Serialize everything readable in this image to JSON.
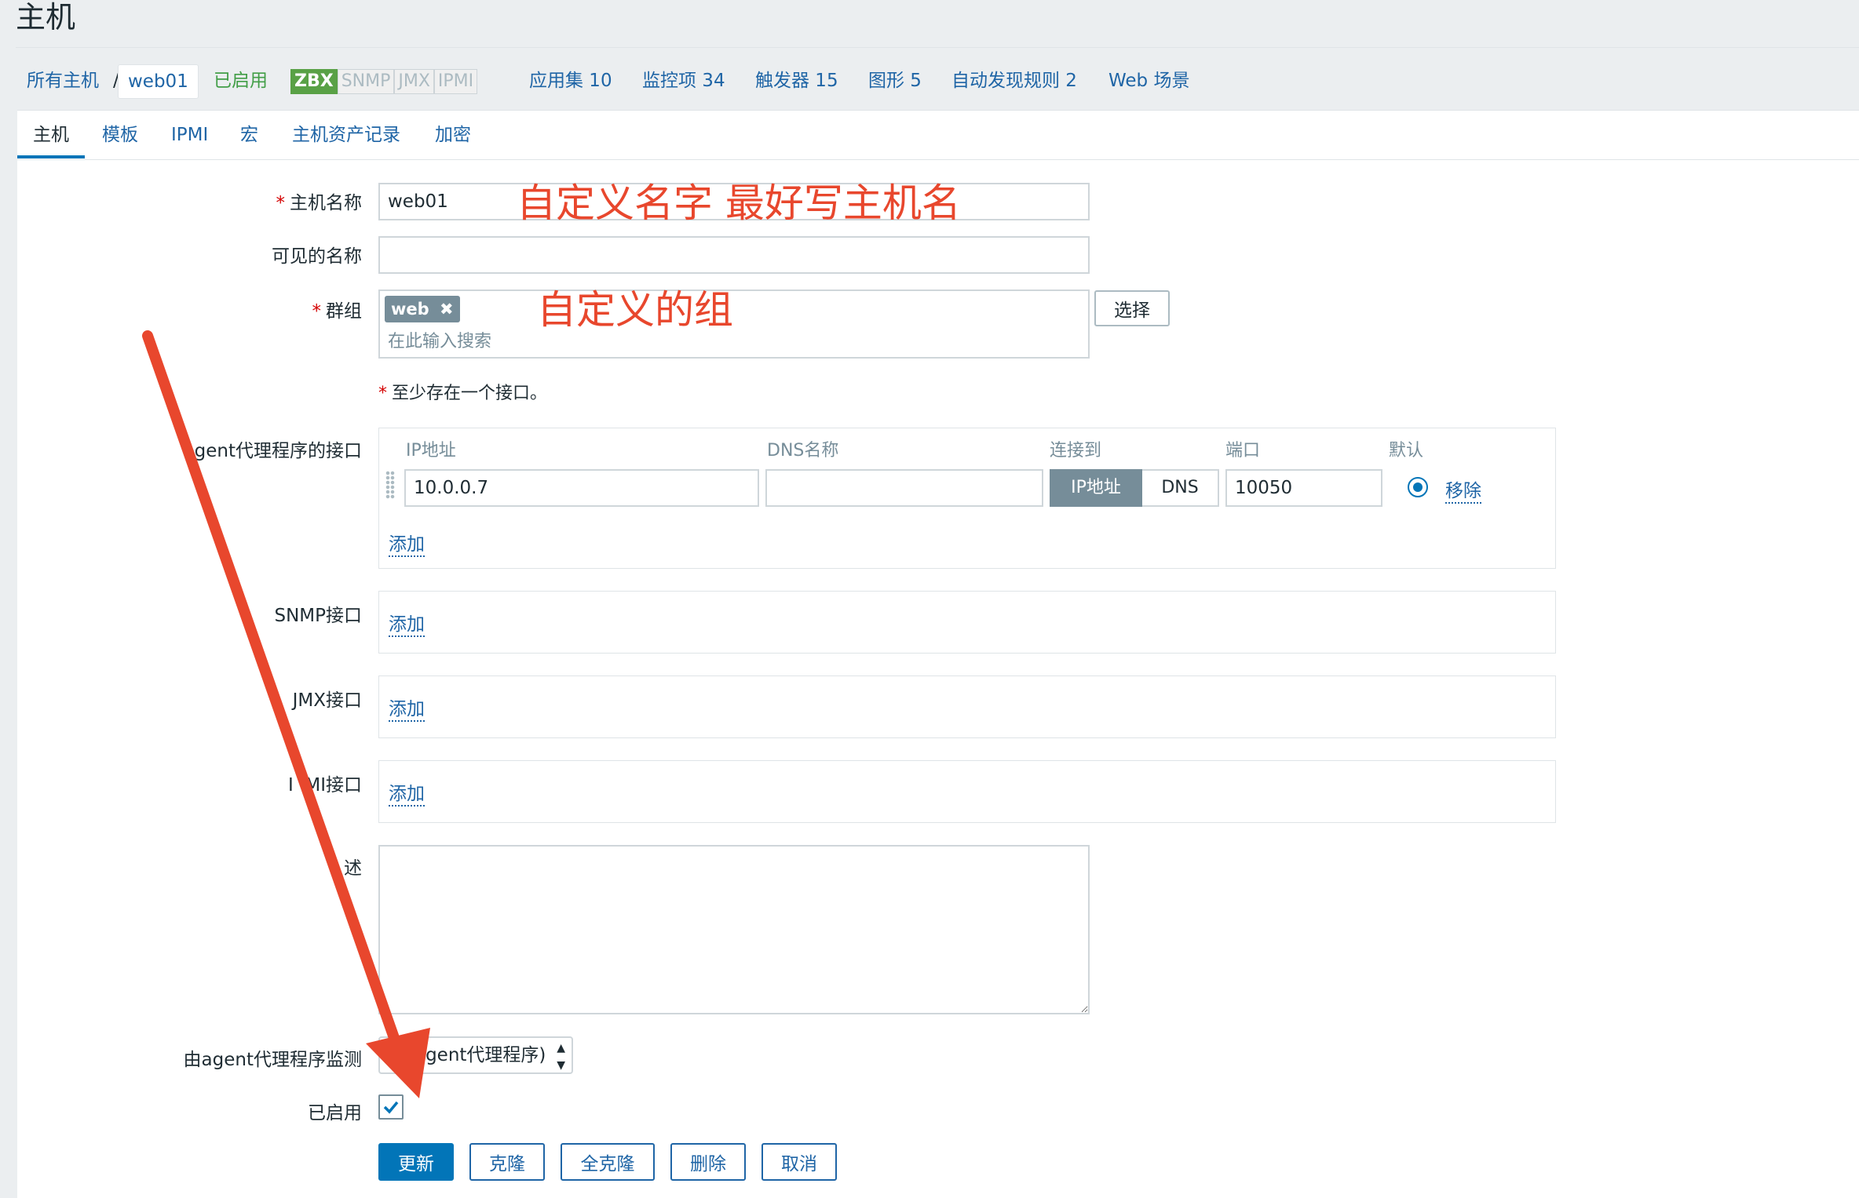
{
  "page": {
    "title": "主机"
  },
  "nav": {
    "all_hosts": "所有主机",
    "separator": "/",
    "current_host": "web01",
    "status": "已启用",
    "interfaces": [
      "ZBX",
      "SNMP",
      "JMX",
      "IPMI"
    ],
    "applications": "应用集 10",
    "items": "监控项 34",
    "triggers": "触发器 15",
    "graphs": "图形 5",
    "discovery": "自动发现规则 2",
    "web": "Web 场景"
  },
  "tabs": [
    "主机",
    "模板",
    "IPMI",
    "宏",
    "主机资产记录",
    "加密"
  ],
  "form": {
    "host_name_label": "主机名称",
    "host_name_value": "web01",
    "visible_name_label": "可见的名称",
    "visible_name_value": "",
    "groups_label": "群组",
    "group_tag": "web",
    "group_tag_remove": "✖",
    "groups_placeholder": "在此输入搜索",
    "select_button": "选择",
    "interface_note": "至少存在一个接口。",
    "agent_iface_label": "gent代理程序的接口",
    "col_ip": "IP地址",
    "col_dns": "DNS名称",
    "col_connect": "连接到",
    "col_port": "端口",
    "col_default": "默认",
    "ip_value": "10.0.0.7",
    "dns_value": "",
    "connect_ip": "IP地址",
    "connect_dns": "DNS",
    "port_value": "10050",
    "remove_link": "移除",
    "add_link": "添加",
    "snmp_label": "SNMP接口",
    "jmx_label": "JMX接口",
    "ipmi_label": "I  MI接口",
    "desc_label": "述",
    "desc_value": "",
    "proxy_label": "由agent代理程序监测",
    "proxy_value": "(无agent代理程序)",
    "enabled_label": "已启用",
    "enabled": true
  },
  "buttons": {
    "update": "更新",
    "clone": "克隆",
    "full_clone": "全克隆",
    "delete": "删除",
    "cancel": "取消"
  },
  "annotations": {
    "name_note": "自定义名字 最好写主机名",
    "group_note": "自定义的组"
  },
  "colors": {
    "accent": "#0275b8",
    "link": "#1f65a6",
    "enabled_green": "#429e47",
    "annotation": "#e8472d"
  }
}
